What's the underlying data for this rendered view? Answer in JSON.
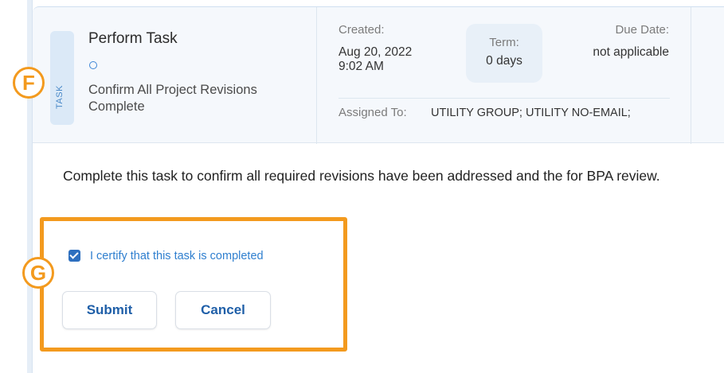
{
  "task": {
    "tag": "TASK",
    "title": "Perform Task",
    "description": "Confirm All Project Revisions Complete",
    "status_icon": "circle-outline-icon"
  },
  "meta": {
    "created_label": "Created:",
    "created_date": "Aug 20, 2022",
    "created_time": "9:02 AM",
    "term_label": "Term:",
    "term_value": "0 days",
    "due_label": "Due Date:",
    "due_value": "not applicable",
    "assigned_label": "Assigned To:",
    "assigned_value": "UTILITY GROUP; UTILITY NO-EMAIL;"
  },
  "body": {
    "instructions": "Complete this task to confirm all required revisions have been addressed and the for BPA review."
  },
  "form": {
    "certify_checked": true,
    "certify_label": "I certify that this task is completed",
    "submit_label": "Submit",
    "cancel_label": "Cancel"
  },
  "annotations": {
    "badge_f": "F",
    "badge_g": "G"
  },
  "colors": {
    "accent": "#2d6fbf",
    "highlight": "#f39a1e",
    "header_bg": "#f5f8fc"
  }
}
